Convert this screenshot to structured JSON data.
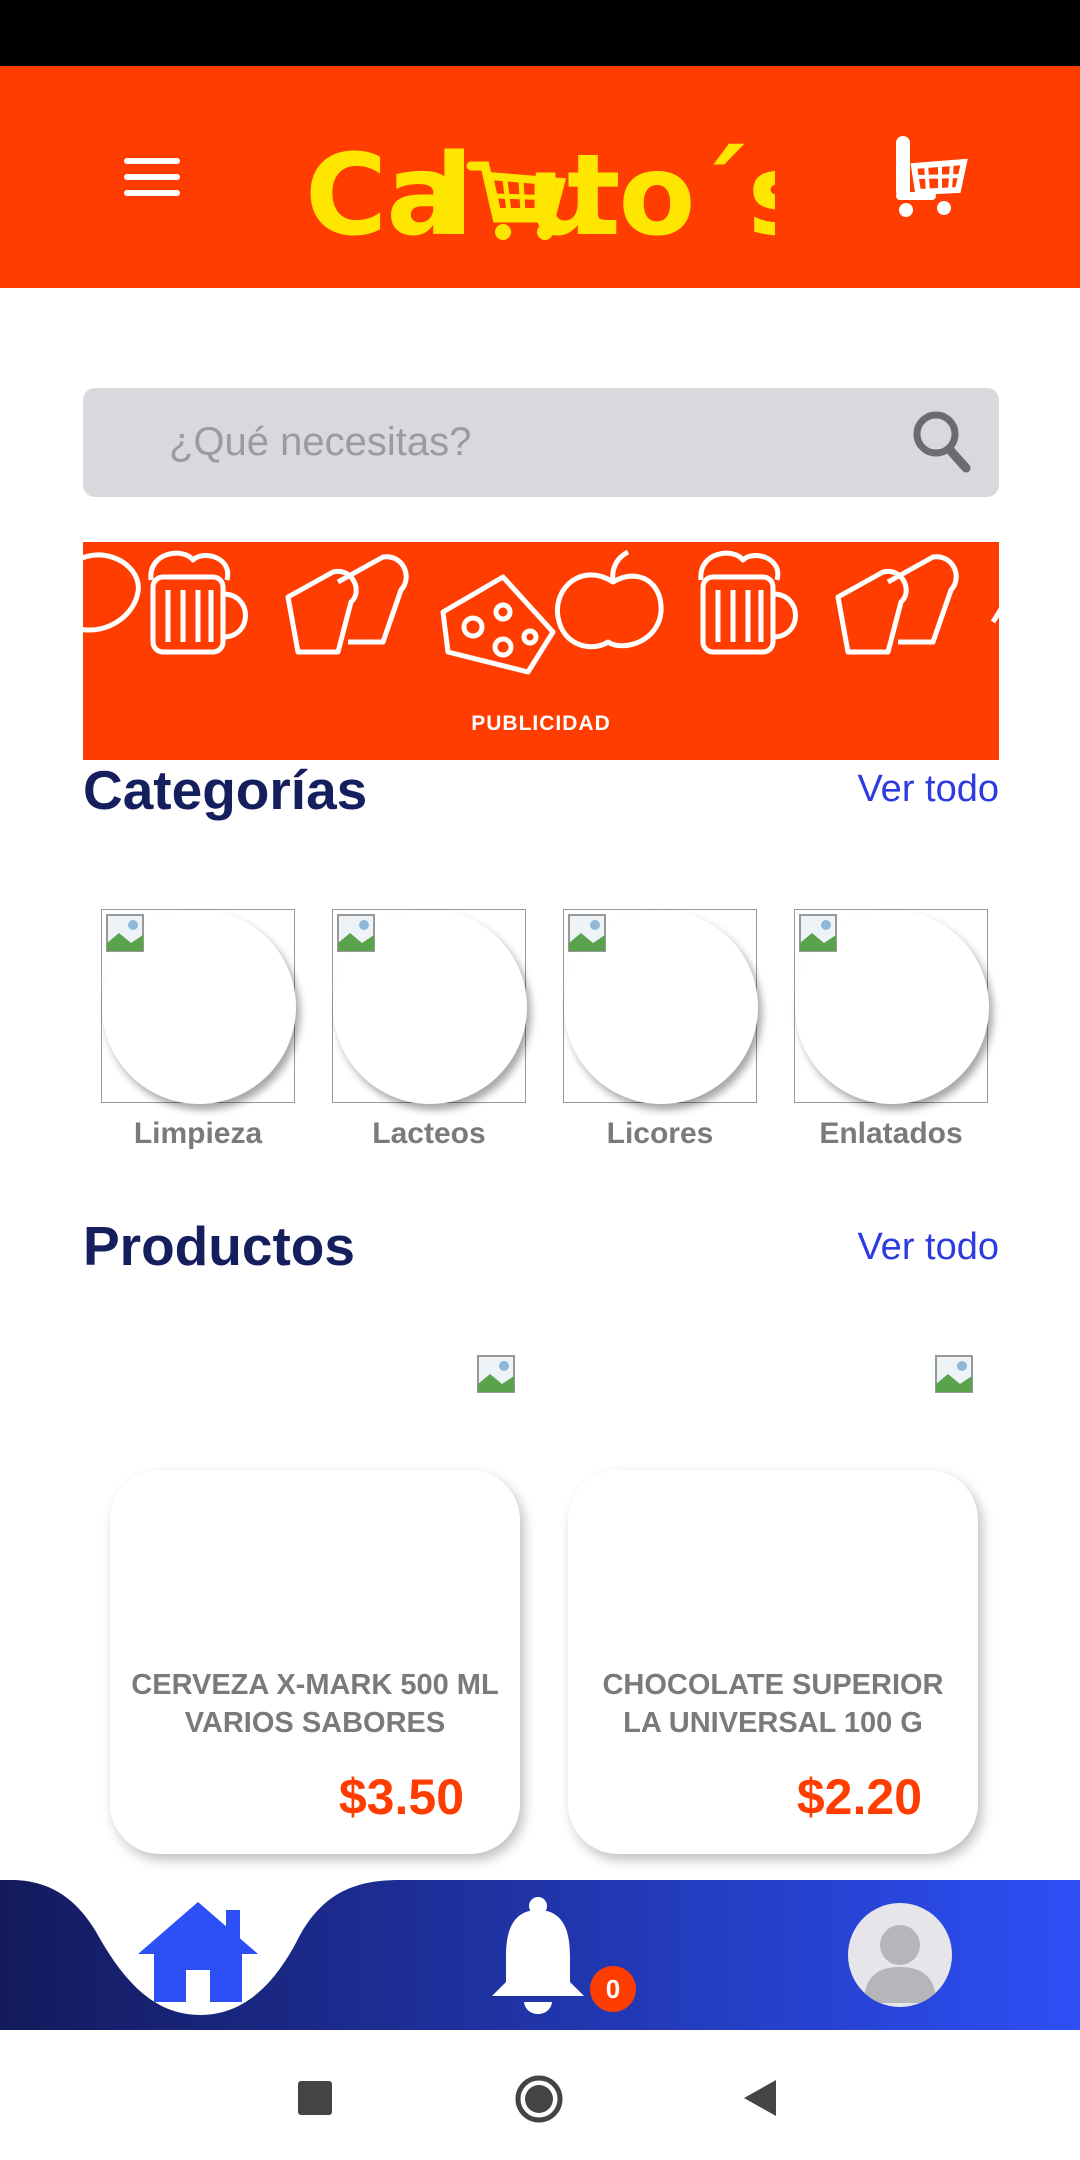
{
  "app": {
    "logo_text": "Cal uto´s",
    "brand_color": "#ff3d00",
    "logo_color": "#ffe600"
  },
  "search": {
    "placeholder": "¿Qué necesitas?"
  },
  "banner": {
    "label": "PUBLICIDAD"
  },
  "categories": {
    "title": "Categorías",
    "see_all": "Ver todo",
    "items": [
      {
        "label": "Limpieza"
      },
      {
        "label": "Lacteos"
      },
      {
        "label": "Licores"
      },
      {
        "label": "Enlatados"
      }
    ]
  },
  "products": {
    "title": "Productos",
    "see_all": "Ver todo",
    "items": [
      {
        "name": "CERVEZA X-MARK 500 ML VARIOS SABORES",
        "price": "$3.50"
      },
      {
        "name": "CHOCOLATE SUPERIOR LA UNIVERSAL 100 G",
        "price": "$2.20"
      }
    ]
  },
  "bottom_nav": {
    "items": [
      {
        "icon": "home-icon"
      },
      {
        "icon": "bell-icon"
      },
      {
        "icon": "avatar-icon"
      }
    ],
    "notification_count": "0",
    "gradient_start": "#131a5c",
    "gradient_end": "#2d4ff6"
  },
  "system_nav": {
    "icons": [
      "recents-icon",
      "home-circle-icon",
      "back-icon"
    ]
  }
}
